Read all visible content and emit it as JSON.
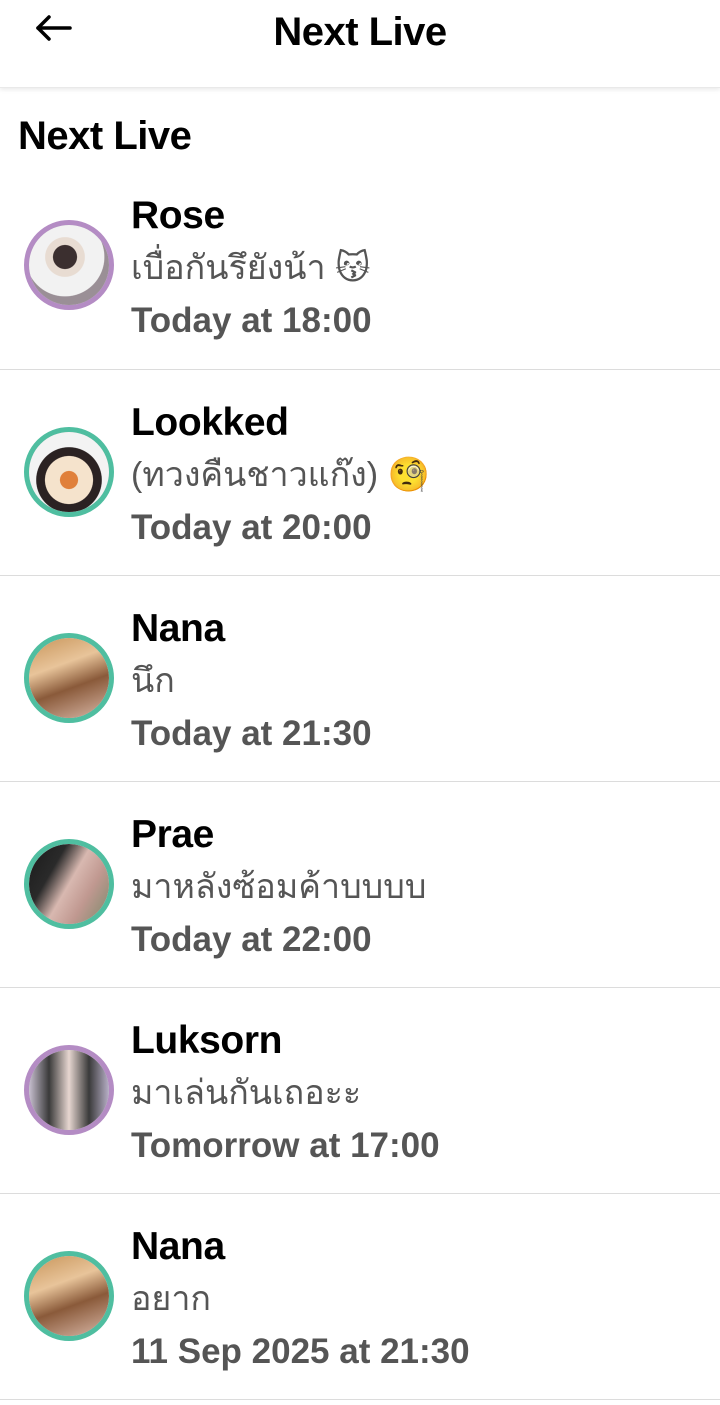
{
  "header": {
    "title": "Next Live",
    "back_icon": "arrow-left-icon"
  },
  "section": {
    "title": "Next Live"
  },
  "schedule": [
    {
      "name": "Rose",
      "message": "เบื่อกันรึยังน้า 😽",
      "when": "Today at 18:00",
      "ring": "#b48cc4"
    },
    {
      "name": "Lookked",
      "message": "(ทวงคืนชาวแก๊ง) 🧐",
      "when": "Today at 20:00",
      "ring": "#4fbea0"
    },
    {
      "name": "Nana",
      "message": "นึก",
      "when": "Today at 21:30",
      "ring": "#4fbea0"
    },
    {
      "name": "Prae",
      "message": "มาหลังซ้อมค้าบบบบ",
      "when": "Today at 22:00",
      "ring": "#4fbea0"
    },
    {
      "name": "Luksorn",
      "message": "มาเล่นกันเถอะะ",
      "when": "Tomorrow at 17:00",
      "ring": "#b48cc4"
    },
    {
      "name": "Nana",
      "message": "อยาก",
      "when": "11 Sep 2025 at 21:30",
      "ring": "#4fbea0"
    }
  ]
}
